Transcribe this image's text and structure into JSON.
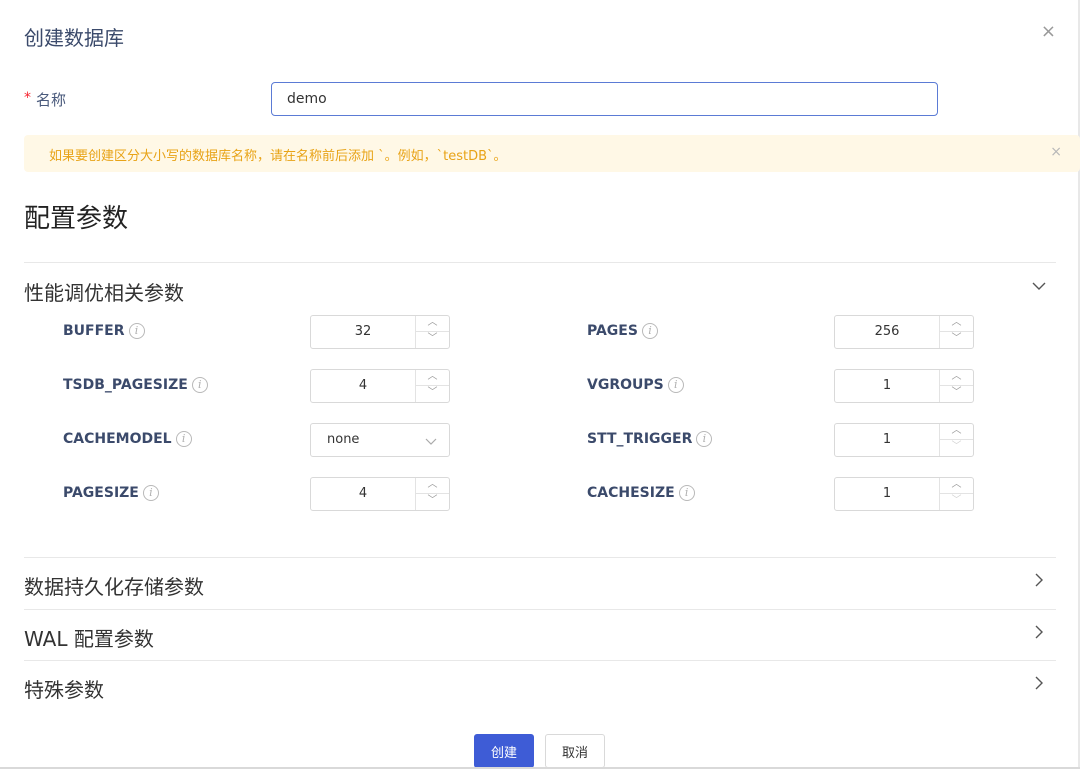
{
  "modal": {
    "title": "创建数据库",
    "close": "×"
  },
  "name_field": {
    "required_mark": "*",
    "label": "名称",
    "value": "demo"
  },
  "alert": {
    "text": "如果要创建区分大小写的数据库名称，请在名称前后添加 `。例如，`testDB`。",
    "close": "×"
  },
  "config": {
    "title": "配置参数"
  },
  "panels": [
    {
      "label": "性能调优相关参数",
      "expanded": true
    },
    {
      "label": "数据持久化存储参数",
      "expanded": false
    },
    {
      "label": "WAL 配置参数",
      "expanded": false
    },
    {
      "label": "特殊参数",
      "expanded": false
    }
  ],
  "params": {
    "buffer": {
      "label": "BUFFER",
      "value": "32"
    },
    "pages": {
      "label": "PAGES",
      "value": "256"
    },
    "tsdb_pagesize": {
      "label": "TSDB_PAGESIZE",
      "value": "4"
    },
    "vgroups": {
      "label": "VGROUPS",
      "value": "1"
    },
    "cachemodel": {
      "label": "CACHEMODEL",
      "value": "none"
    },
    "stt_trigger": {
      "label": "STT_TRIGGER",
      "value": "1"
    },
    "pagesize": {
      "label": "PAGESIZE",
      "value": "4"
    },
    "cachesize": {
      "label": "CACHESIZE",
      "value": "1"
    }
  },
  "icons": {
    "info": "i"
  },
  "footer": {
    "create_label": "创建",
    "cancel_label": "取消"
  },
  "colors": {
    "primary": "#3e5cd6",
    "alert_bg": "#fff8e6",
    "alert_text": "#e8a317",
    "label": "#3b4a6b",
    "required": "#f5222d"
  }
}
